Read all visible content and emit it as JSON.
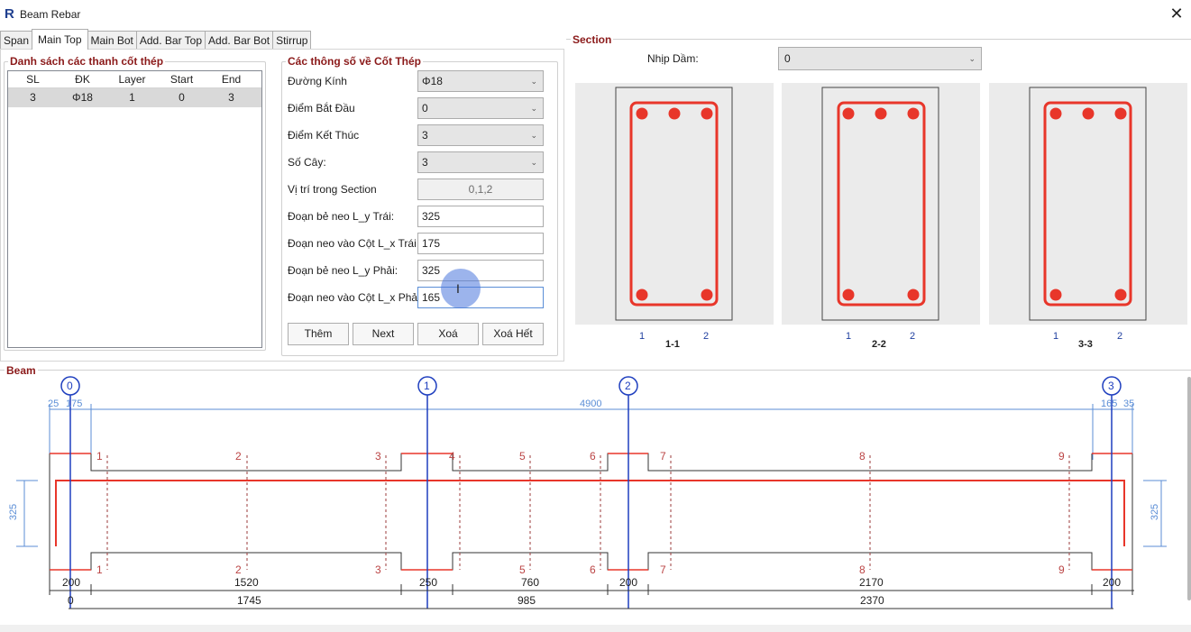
{
  "window": {
    "title": "Beam Rebar",
    "app_icon_letter": "R",
    "close_glyph": "✕"
  },
  "tabs": [
    "Span",
    "Main Top",
    "Main Bot",
    "Add. Bar Top",
    "Add. Bar Bot",
    "Stirrup"
  ],
  "active_tab": "Main Top",
  "list": {
    "title": "Danh sách các thanh cốt thép",
    "columns": [
      "SL",
      "ĐK",
      "Layer",
      "Start",
      "End"
    ],
    "rows": [
      [
        "3",
        "Φ18",
        "1",
        "0",
        "3"
      ]
    ]
  },
  "params": {
    "title": "Các thông số về Cốt Thép",
    "duong_kinh": {
      "label": "Đường Kính",
      "value": "Φ18"
    },
    "diem_bat_dau": {
      "label": "Điểm Bắt Đầu",
      "value": "0"
    },
    "diem_ket_thuc": {
      "label": "Điểm Kết Thúc",
      "value": "3"
    },
    "so_cay": {
      "label": "Số Cây:",
      "value": "3"
    },
    "vi_tri": {
      "label": "Vị trí trong Section",
      "value": "0,1,2"
    },
    "be_neo_trai": {
      "label": "Đoạn bẻ neo L_y Trái:",
      "value": "325"
    },
    "neo_cot_trai": {
      "label": "Đoạn neo vào Cột L_x Trái",
      "value": "175"
    },
    "be_neo_phai": {
      "label": "Đoạn bẻ neo L_y Phải:",
      "value": "325"
    },
    "neo_cot_phai": {
      "label": "Đoạn neo vào Cột L_x Phải",
      "value": "165"
    }
  },
  "buttons": {
    "them": "Thêm",
    "next": "Next",
    "xoa": "Xoá",
    "xoa_het": "Xoá Hết"
  },
  "section": {
    "title": "Section",
    "nhip_label": "Nhịp Dầm:",
    "nhip_value": "0",
    "cuts": [
      {
        "label": "1-1",
        "left": "1",
        "right": "2"
      },
      {
        "label": "2-2",
        "left": "1",
        "right": "2"
      },
      {
        "label": "3-3",
        "left": "1",
        "right": "2"
      }
    ]
  },
  "beam": {
    "title": "Beam",
    "axes": [
      "0",
      "1",
      "2",
      "3"
    ],
    "top_dims": [
      "25",
      "175",
      "4900",
      "165",
      "35"
    ],
    "side_dims": [
      "325",
      "325"
    ],
    "point_labels": [
      "1",
      "2",
      "3",
      "4",
      "5",
      "6",
      "7",
      "8",
      "9"
    ],
    "bottom_point_labels": [
      "1",
      "2",
      "3",
      "5",
      "6",
      "7",
      "8",
      "9"
    ],
    "bottom_dims_row1": [
      "200",
      "1520",
      "250",
      "760",
      "200",
      "2170",
      "200"
    ],
    "bottom_dims_row2": [
      "0",
      "1745",
      "985",
      "2370"
    ]
  },
  "colors": {
    "accent_red": "#e8362a",
    "title_red": "#8b1a1a",
    "axis_blue": "#1f3f9f",
    "dim_blue": "#5b8ed6"
  }
}
